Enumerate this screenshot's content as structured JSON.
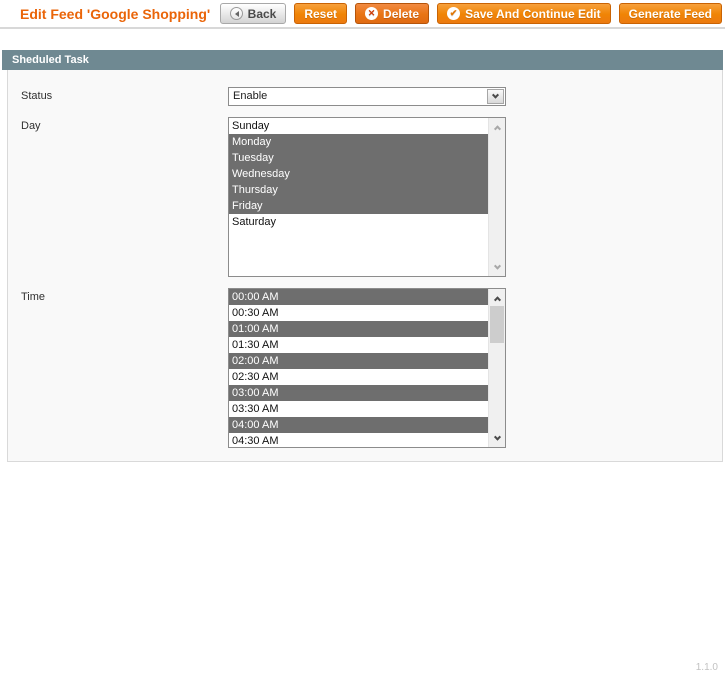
{
  "header": {
    "title": "Edit Feed 'Google Shopping'",
    "buttons": {
      "back": "Back",
      "reset": "Reset",
      "delete": "Delete",
      "save_and_continue": "Save And Continue Edit",
      "generate_feed": "Generate Feed"
    }
  },
  "section": {
    "title": "Sheduled Task"
  },
  "form": {
    "status": {
      "label": "Status",
      "value": "Enable"
    },
    "day": {
      "label": "Day",
      "options": [
        {
          "label": "Sunday",
          "selected": false
        },
        {
          "label": "Monday",
          "selected": true
        },
        {
          "label": "Tuesday",
          "selected": true
        },
        {
          "label": "Wednesday",
          "selected": true
        },
        {
          "label": "Thursday",
          "selected": true
        },
        {
          "label": "Friday",
          "selected": true
        },
        {
          "label": "Saturday",
          "selected": false
        }
      ]
    },
    "time": {
      "label": "Time",
      "options": [
        {
          "label": "00:00 AM",
          "selected": true
        },
        {
          "label": "00:30 AM",
          "selected": false
        },
        {
          "label": "01:00 AM",
          "selected": true
        },
        {
          "label": "01:30 AM",
          "selected": false
        },
        {
          "label": "02:00 AM",
          "selected": true
        },
        {
          "label": "02:30 AM",
          "selected": false
        },
        {
          "label": "03:00 AM",
          "selected": true
        },
        {
          "label": "03:30 AM",
          "selected": false
        },
        {
          "label": "04:00 AM",
          "selected": true
        },
        {
          "label": "04:30 AM",
          "selected": false
        }
      ]
    }
  },
  "footer": {
    "version": "1.1.0"
  },
  "icons": {
    "back": "back-arrow-icon",
    "delete": "x-circle-icon",
    "save": "check-circle-icon",
    "delete_glyph": "✕",
    "save_glyph": "✔"
  },
  "colors": {
    "title_orange": "#ea6509",
    "button_orange_top": "#f7a03c",
    "button_orange_bottom": "#ec7a10",
    "section_header_bg": "#6f8992",
    "selected_option_bg": "#6e6e6e",
    "panel_bg": "#f9f9f9"
  }
}
